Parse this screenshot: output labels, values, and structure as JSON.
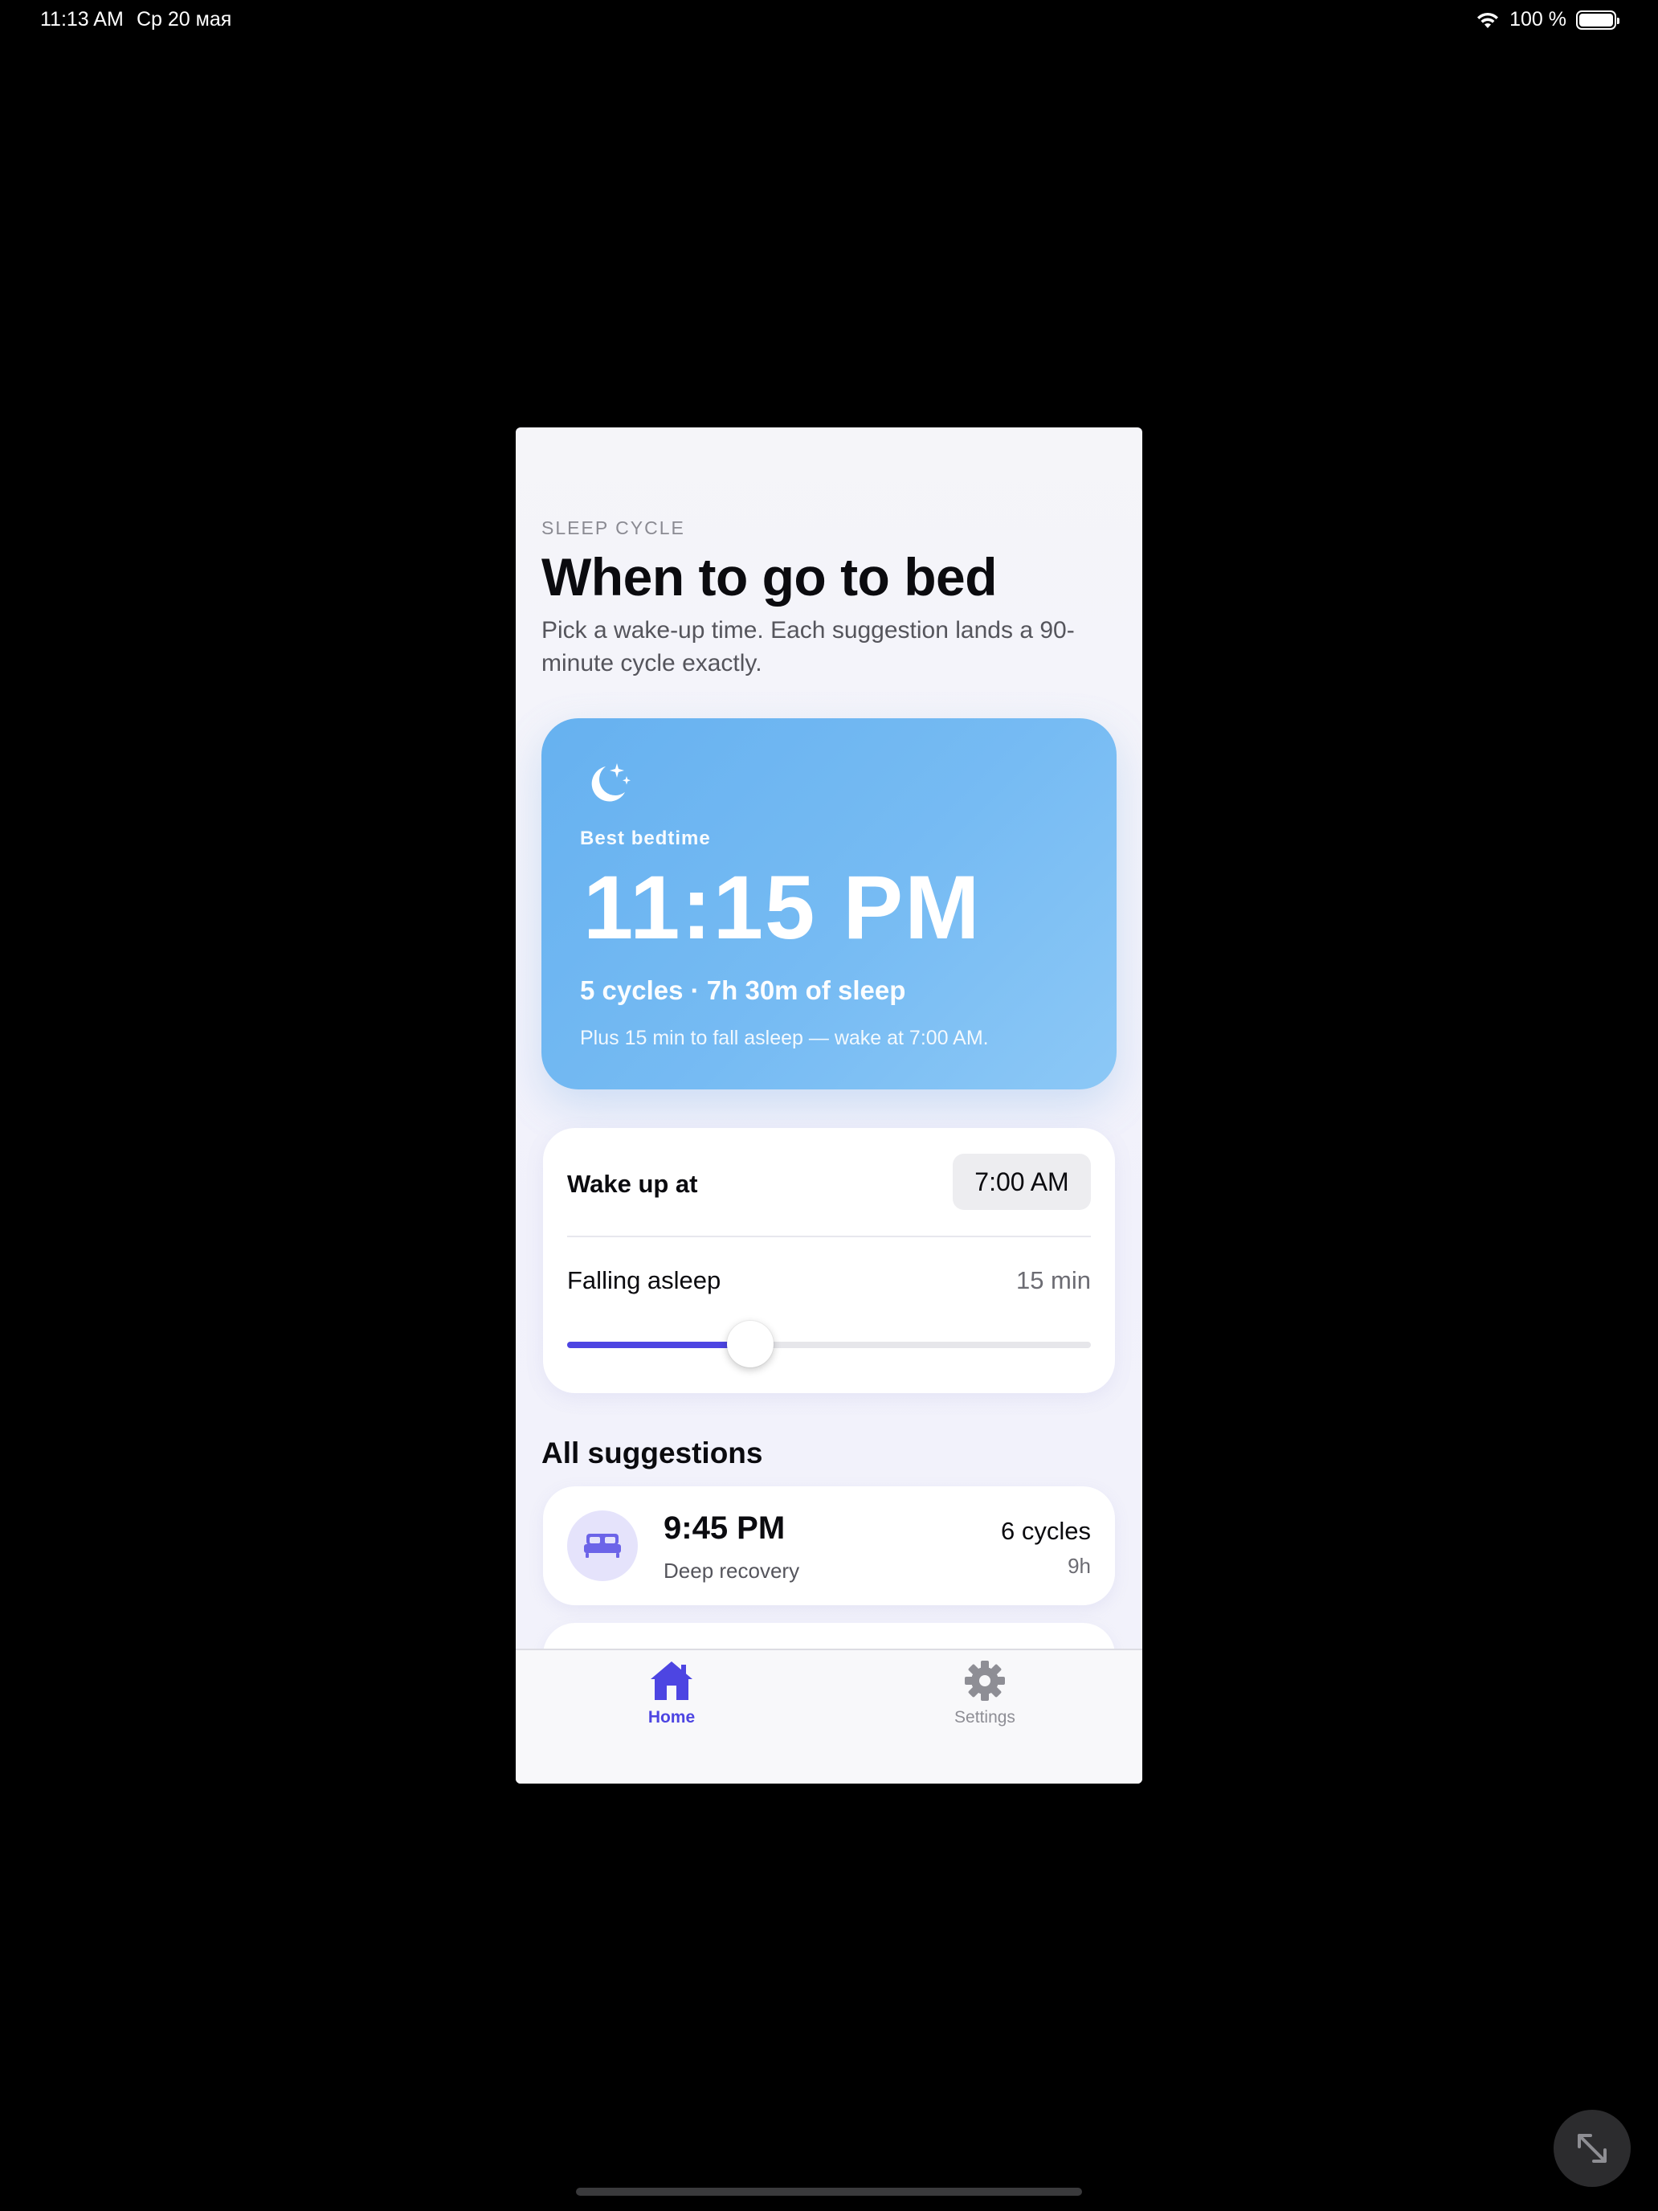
{
  "status_bar": {
    "time": "11:13 AM",
    "date": "Ср 20 мая",
    "battery": "100 %"
  },
  "header": {
    "eyebrow": "SLEEP CYCLE",
    "title": "When to go to bed",
    "subtitle": "Pick a wake-up time. Each suggestion lands a 90-minute cycle exactly."
  },
  "hero": {
    "label": "Best bedtime",
    "time": "11:15 PM",
    "cycles": "5 cycles · 7h 30m of sleep",
    "note": "Plus 15 min to fall asleep — wake at 7:00 AM.",
    "icon": "moon-stars-icon"
  },
  "settings": {
    "wake_label": "Wake up at",
    "wake_value": "7:00 AM",
    "fall_label": "Falling asleep",
    "fall_value": "15 min",
    "slider_fraction": 0.35
  },
  "suggestions": {
    "title": "All suggestions",
    "items": [
      {
        "time": "9:45 PM",
        "desc": "Deep recovery",
        "cycles": "6 cycles",
        "hours": "9h",
        "icon": "bed-icon"
      }
    ]
  },
  "tabbar": {
    "home_label": "Home",
    "settings_label": "Settings"
  },
  "colors": {
    "accent": "#4d45e2",
    "hero": "#6cb5f2",
    "background": "#f3f3fa"
  }
}
